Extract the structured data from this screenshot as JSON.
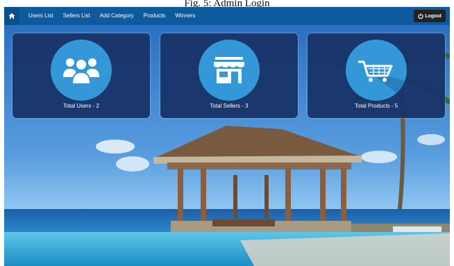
{
  "caption": "Fig. 5: Admin Login",
  "navbar": {
    "home_icon": "home-icon",
    "items": [
      "Users List",
      "Sellers List",
      "Add Category",
      "Products",
      "Winners"
    ],
    "logout_label": "Logout",
    "logout_icon": "power-icon",
    "color": "#0e5a9e"
  },
  "cards": [
    {
      "label": "Total Users - 2",
      "icon": "users-icon"
    },
    {
      "label": "Total Sellers - 3",
      "icon": "store-icon"
    },
    {
      "label": "Total Products - 5",
      "icon": "shopping-cart-icon"
    }
  ],
  "colors": {
    "card_bg": "#18346a",
    "circle": "#3497d8"
  }
}
